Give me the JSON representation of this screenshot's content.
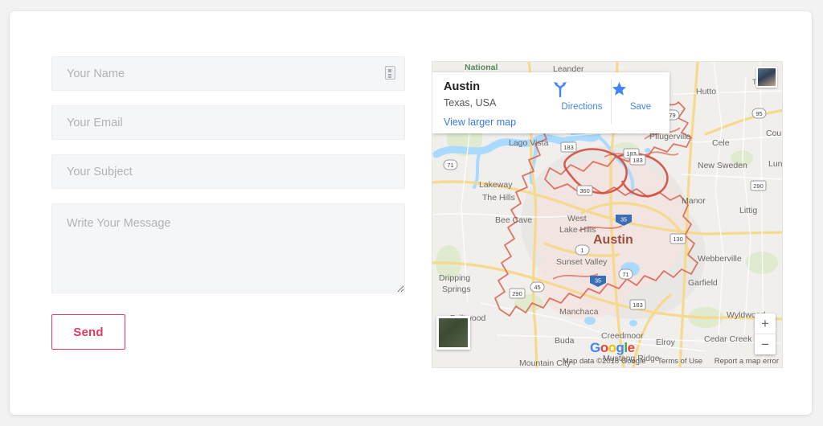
{
  "form": {
    "name_placeholder": "Your Name",
    "name_value": "",
    "name_icon": "id-card-icon",
    "email_placeholder": "Your Email",
    "email_value": "",
    "subject_placeholder": "Your Subject",
    "subject_value": "",
    "message_placeholder": "Write Your Message",
    "message_value": "",
    "send_label": "Send",
    "accent_color": "#e03a63",
    "field_bg": "#f5f6f8"
  },
  "map": {
    "info": {
      "title": "Austin",
      "subtitle": "Texas, USA",
      "link": "View larger map",
      "directions_label": "Directions",
      "save_label": "Save"
    },
    "controls": {
      "zoom_in": "+",
      "zoom_out": "−"
    },
    "brand": {
      "g1": "G",
      "o1": "o",
      "o2": "o",
      "g2": "g",
      "l": "l",
      "e": "e"
    },
    "attribution": {
      "map_data": "Map data ©2018 Google",
      "terms": "Terms of Use",
      "report": "Report a map error"
    },
    "center_label": "Austin",
    "place_labels": [
      "National",
      "Leander",
      "Hutto",
      "Taylor",
      "Pflugerville",
      "Cele",
      "New Sweden",
      "Coupland",
      "Lund",
      "Lago Vista",
      "Lakeway",
      "The Hills",
      "Bee Cave",
      "West",
      "Lake Hills",
      "Manor",
      "Littig",
      "Webberville",
      "Garfield",
      "Sunset Valley",
      "Dripping",
      "Springs",
      "Manchaca",
      "Driftwood",
      "Buda",
      "Creedmoor",
      "Elroy",
      "Wyldwood",
      "Cedar Creek",
      "Mustang Ridge",
      "Mountain City"
    ],
    "highway_shields": [
      "79",
      "95",
      "183",
      "71",
      "360",
      "1",
      "35",
      "290",
      "130",
      "45"
    ],
    "colors": {
      "land": "#f1efec",
      "water": "#aadaff",
      "road": "#f6d98a",
      "boundary": "#d9604f",
      "green": "#d5e6c8"
    }
  }
}
